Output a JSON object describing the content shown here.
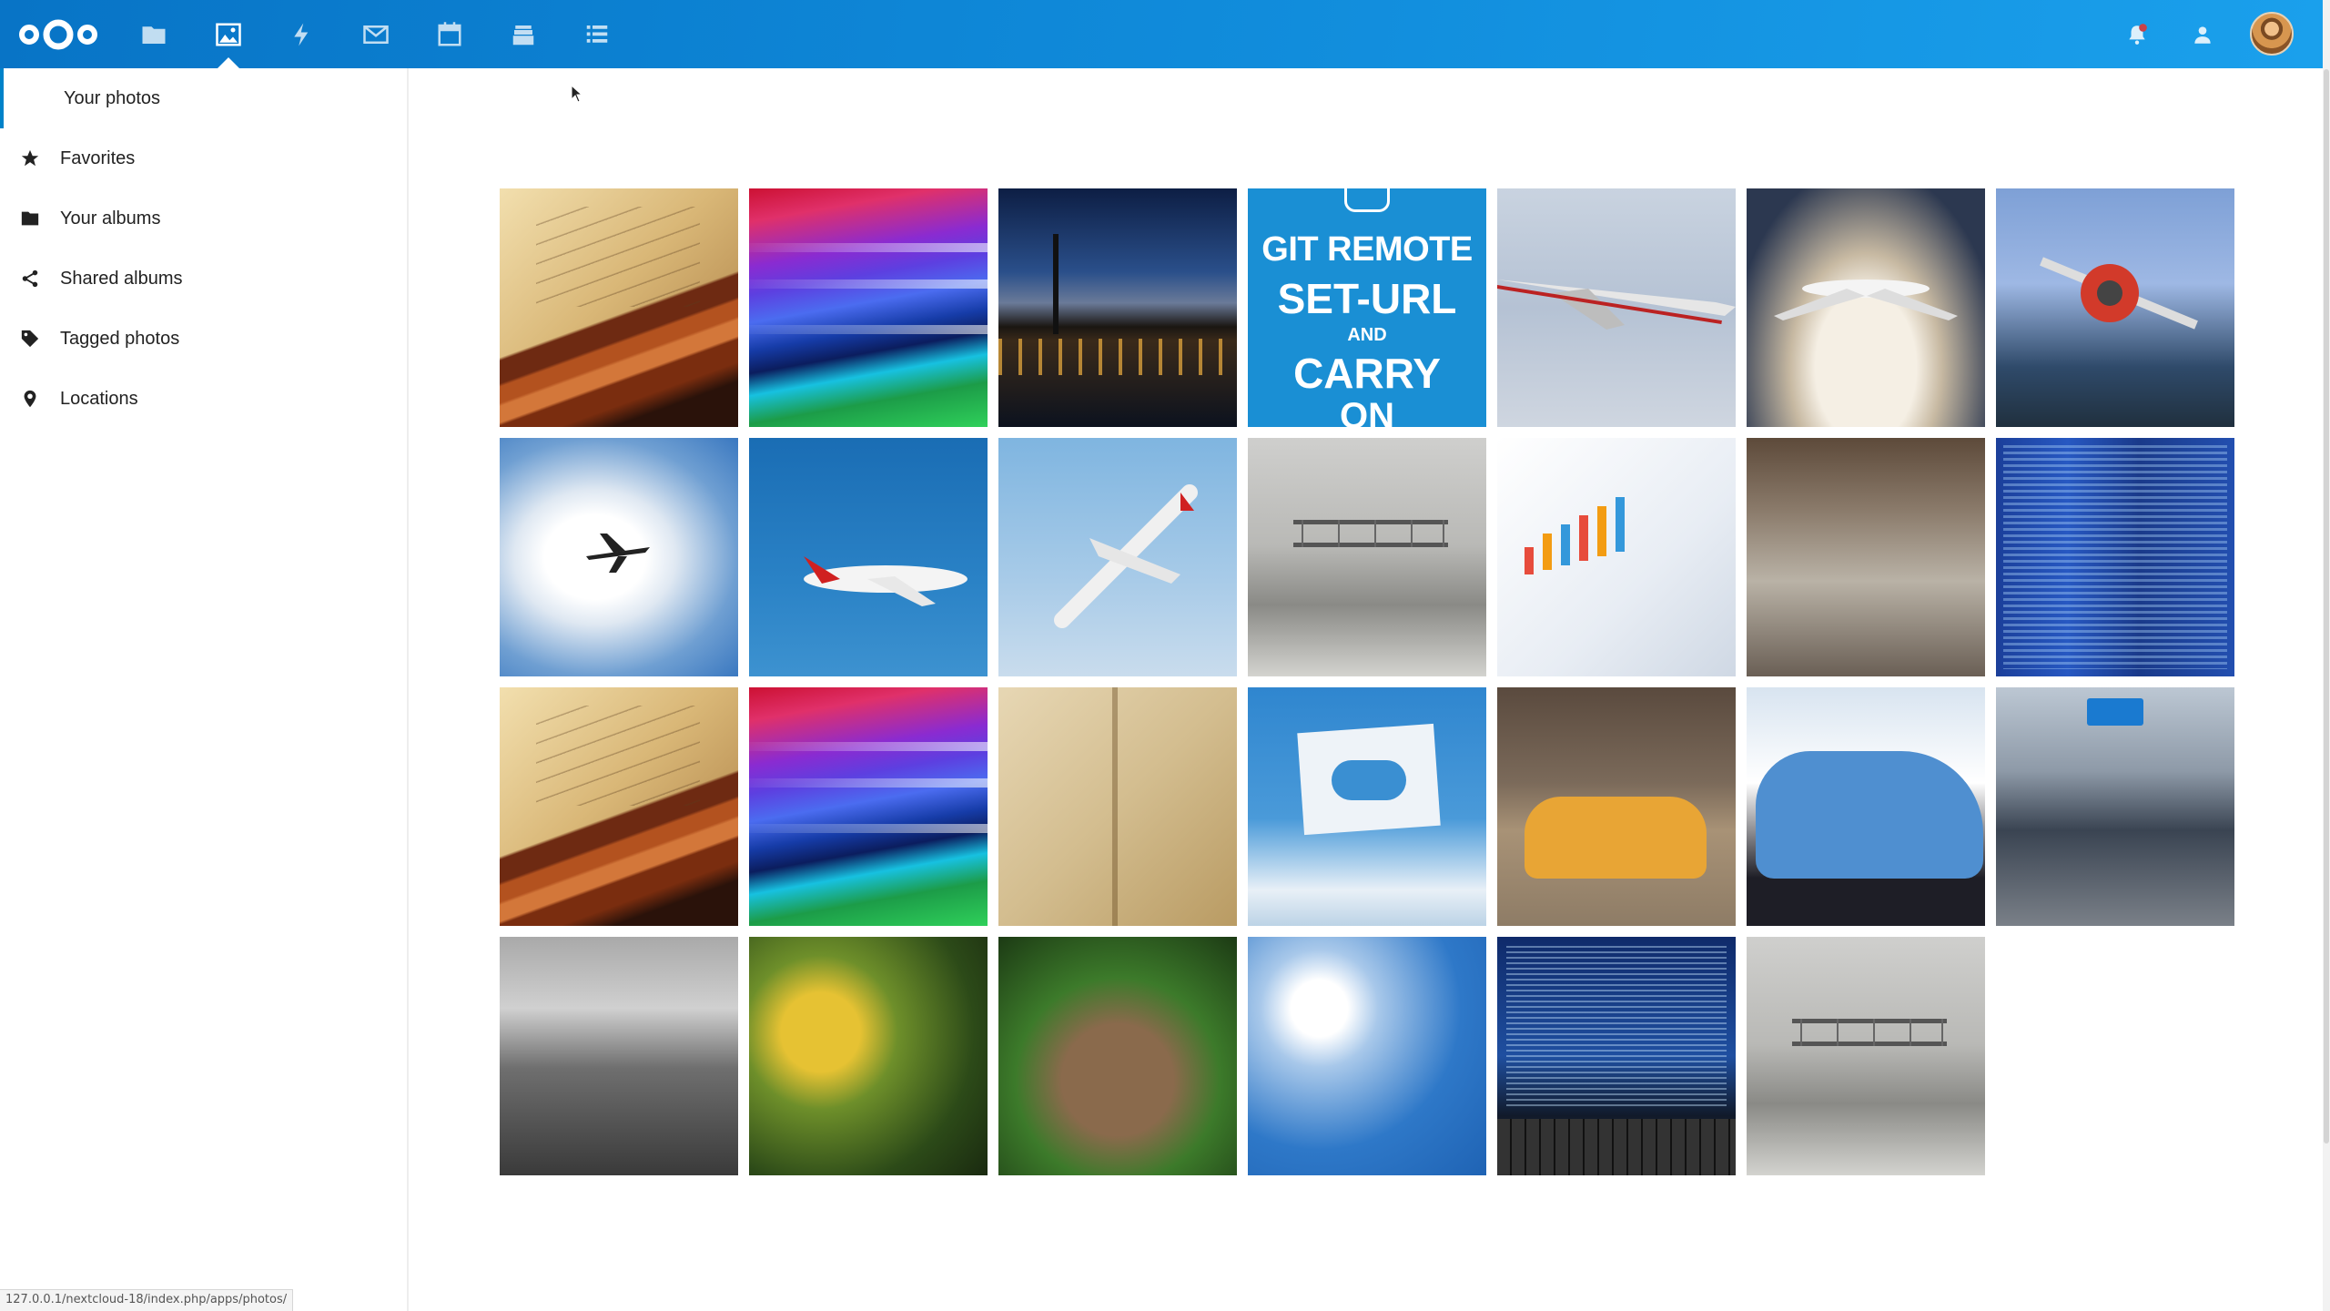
{
  "header": {
    "apps": [
      {
        "name": "files-app-icon",
        "icon": "folder"
      },
      {
        "name": "photos-app-icon",
        "icon": "image",
        "active": true
      },
      {
        "name": "activity-app-icon",
        "icon": "lightning"
      },
      {
        "name": "mail-app-icon",
        "icon": "envelope"
      },
      {
        "name": "calendar-app-icon",
        "icon": "calendar"
      },
      {
        "name": "deck-app-icon",
        "icon": "stacked-cards"
      },
      {
        "name": "tasks-app-icon",
        "icon": "list"
      }
    ],
    "accent": "#0082c9"
  },
  "sidebar": {
    "items": [
      {
        "label": "Your photos",
        "icon": "none",
        "active": true
      },
      {
        "label": "Favorites",
        "icon": "star-icon"
      },
      {
        "label": "Your albums",
        "icon": "folder-icon"
      },
      {
        "label": "Shared albums",
        "icon": "share-icon"
      },
      {
        "label": "Tagged photos",
        "icon": "tag-icon"
      },
      {
        "label": "Locations",
        "icon": "location-pin-icon"
      }
    ]
  },
  "photos": {
    "git_poster": {
      "line1": "GIT REMOTE",
      "line2": "SET-URL",
      "line3": "AND",
      "line4": "CARRY",
      "line5": "ON"
    }
  },
  "status_url": "127.0.0.1/nextcloud-18/index.php/apps/photos/"
}
